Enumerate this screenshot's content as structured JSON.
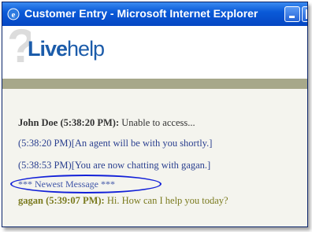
{
  "window": {
    "title": "Customer Entry - Microsoft Internet Explorer"
  },
  "header": {
    "logo_live": "Live",
    "logo_help": "help"
  },
  "chat": {
    "messages": [
      {
        "sender": "John Doe (5:38:20 PM):",
        "text": " Unable to access..."
      },
      {
        "text": "(5:38:20 PM)[An agent will be with you shortly.]"
      },
      {
        "text": "(5:38:53 PM)[You are now chatting with gagan.]"
      },
      {
        "text": "*** Newest Message ***"
      },
      {
        "sender": "gagan (5:39:07 PM):",
        "text": " Hi. How can I help you today?"
      }
    ]
  },
  "colors": {
    "titlebar": "#0a5ad8",
    "logo": "#1c5caa",
    "divider_bar": "#a7a88a",
    "system_message": "#2a3f8f",
    "agent_message": "#7a7a1e",
    "highlight_oval": "#1220d8"
  },
  "icons": [
    "ie-icon",
    "minimize-icon",
    "maximize-icon",
    "question-mark-icon"
  ]
}
